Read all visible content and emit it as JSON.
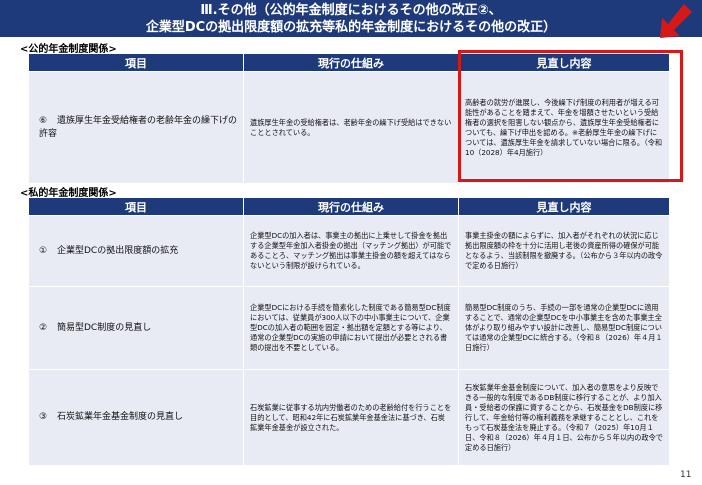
{
  "banner": {
    "line1": "Ⅲ.その他（公的年金制度におけるその他の改正②、",
    "line2": "企業型DCの拠出限度額の拡充等私的年金制度におけるその他の改正）"
  },
  "public_section": {
    "label": "<公的年金制度関係>",
    "headers": [
      "項目",
      "現行の仕組み",
      "見直し内容"
    ],
    "rows": [
      {
        "num": "⑥",
        "item": "遺族厚生年金受給権者の老齢年金の繰下げの許容",
        "current": "遺族厚生年金の受給権者は、老齢年金の繰下げ受給はできないこととされている。",
        "revision": "高齢者の就労が進展し、今後繰下げ制度の利用者が増える可能性があることを踏まえて、年金を増額させたいという受給権者の選択を阻害しない観点から、遺族厚生年金受給権者についても、繰下げ申出を認める。※老齢厚生年金の繰下げについては、遺族厚生年金を請求していない場合に限る。（令和10（2028）年4月施行）"
      }
    ]
  },
  "private_section": {
    "label": "<私的年金制度関係>",
    "headers": [
      "項目",
      "現行の仕組み",
      "見直し内容"
    ],
    "rows": [
      {
        "num": "①",
        "item": "企業型DCの拠出限度額の拡充",
        "current": "企業型DCの加入者は、事業主の拠出に上乗せして掛金を拠出する企業型年金加入者掛金の拠出（マッチング拠出）が可能であることろ、マッチング拠出は事業主掛金の額を超えてはならないという制限が設けられている。",
        "revision": "事業主掛金の額によらずに、加入者がそれぞれの状況に応じ拠出限度額の枠を十分に活用し老後の資産所得の確保が可能となるよう、当該制限を撤廃する。（公布から３年以内の政令で定める日施行）"
      },
      {
        "num": "②",
        "item": "簡易型DC制度の見直し",
        "current": "企業型DCにおける手続を簡素化した制度である簡易型DC制度においては、従業員が300人以下の中小事業主について、企業型DCの加入者の範囲を固定・拠出額を定額とする等により、通常の企業型DCの実施の申請において提出が必要とされる書類の提出を不要としている。",
        "revision": "簡易型DC制度のうち、手続の一部を通常の企業型DCに適用することで、通常の企業型DCを中小事業主を含めた事業主全体がより取り組みやすい設計に改善し、簡易型DC制度については通常の企業型DCに統合する。（令和８（2026）年４月１日施行）"
      },
      {
        "num": "③",
        "item": "石炭鉱業年金基金制度の見直し",
        "current": "石炭鉱業に従事する坑内労働者のための老齢給付を行うことを目的として、昭和42年に石炭鉱業年金基金法に基づき、石炭鉱業年金基金が設立された。",
        "revision": "石炭鉱業年金基金制度について、加入者の意思をより反映できる一般的な制度であるDB制度に移行することが、より加入員・受給者の保護に資することから、石炭基金をDB制度に移行して、年金給付等の権利義務を承継することとし、これをもって石炭基金法を廃止する。（令和７（2025）年10月１日、令和８（2026）年４月１日、公布から５年以内の政令で定める日施行）"
      }
    ]
  },
  "page_number": "11",
  "colors": {
    "header_bg": "#1f3a7a",
    "cell_bg": "#e8eaf4",
    "highlight": "#d51818"
  }
}
